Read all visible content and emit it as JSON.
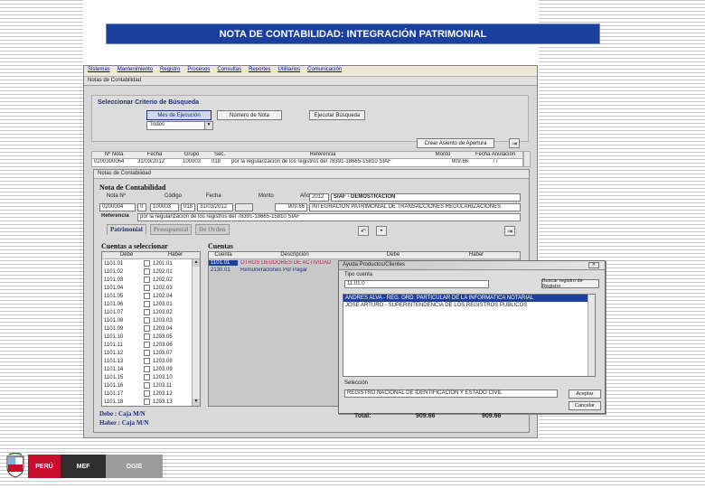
{
  "slide": {
    "title": "NOTA DE CONTABILIDAD: INTEGRACIÓN PATRIMONIAL"
  },
  "menu": [
    "Sistemas",
    "Mantenimiento",
    "Registro",
    "Procesos",
    "Consultas",
    "Reportes",
    "Utilitarios",
    "Comunicación"
  ],
  "window_title": "Notas de Contabilidad",
  "criteria": {
    "legend": "Seleccionar Criterio de Búsqueda",
    "btn_mes": "Mes de Ejecución",
    "btn_numero": "Número de Nota",
    "btn_ejecutar": "Ejecutar Búsqueda",
    "select_value": "Todos",
    "btn_crear": "Crear Asiento de Apertura"
  },
  "grid": {
    "headers": [
      "Nº Nota",
      "Fecha",
      "Grupo",
      "Sec.",
      "Referencia",
      "Monto",
      "Fecha Anulación"
    ],
    "row": [
      "0200300064",
      "31/03/2012",
      "100003",
      "018",
      "por la regularización de los registros del 78391-18665-15810 SIAF",
      "909.66",
      "/ /"
    ]
  },
  "nota": {
    "window_title": "Notas de Contabilidad",
    "heading": "Nota de Contabilidad",
    "labels": [
      "Nota Nº",
      "Código",
      "Fecha",
      "Monto",
      "Año"
    ],
    "numero": "0200004",
    "sec": "0",
    "codigo": "100003",
    "sub": "018",
    "fecha": "31/03/2012",
    "monto": "909.66",
    "anio": "2012",
    "tipo": "SIAF - DEMOSTRACION",
    "descripcion": "INTEGRACION PATRIMONIAL DE TRANSACCIONES REGULARIZACIONES",
    "referencia_label": "Referencia",
    "referencia": "por la regularización de los registros del 78391-18665-15810 SIAF"
  },
  "tabs": [
    "Patrimonial",
    "Presupuestal",
    "De Orden"
  ],
  "cuentas_sel": {
    "title": "Cuentas a seleccionar",
    "col_debe": "Debe",
    "col_haber": "Haber",
    "rows": [
      [
        "1101.01",
        "1201.01"
      ],
      [
        "1101.02",
        "1202.01"
      ],
      [
        "1101.03",
        "1202.02"
      ],
      [
        "1101.04",
        "1202.03"
      ],
      [
        "1101.05",
        "1202.04"
      ],
      [
        "1101.06",
        "1203.01"
      ],
      [
        "1101.07",
        "1203.02"
      ],
      [
        "1101.08",
        "1203.03"
      ],
      [
        "1101.09",
        "1203.04"
      ],
      [
        "1101.10",
        "1203.05"
      ],
      [
        "1101.11",
        "1203.06"
      ],
      [
        "1101.12",
        "1203.07"
      ],
      [
        "1101.13",
        "1203.08"
      ],
      [
        "1101.14",
        "1203.09"
      ],
      [
        "1101.15",
        "1203.10"
      ],
      [
        "1101.16",
        "1203.11"
      ],
      [
        "1101.17",
        "1203.12"
      ],
      [
        "1101.18",
        "1203.13"
      ]
    ]
  },
  "cuentas": {
    "title": "Cuentas",
    "headers": [
      "Cuenta",
      "Descripción",
      "Debe",
      "Haber"
    ],
    "rows": [
      {
        "cuenta": "1101.01",
        "desc": "OTROS DEUDORES DE ACTIVIDAD"
      },
      {
        "cuenta": "2130.01",
        "desc": "Remuneraciones Por Pagar"
      }
    ]
  },
  "debe_text": "Debe : Caja M/N",
  "haber_text": "Haber : Caja M/N",
  "total": {
    "label": "Total:",
    "debe": "909.66",
    "haber": "909.66"
  },
  "popup": {
    "title": "Ayuda Productos/Clientes",
    "label_search": "Tipo cuenta",
    "search_value": "11.01.0",
    "btn_buscar": "Buscar registro de Registro",
    "items": [
      "ANDRES ALVA - REG. ORD. PARTICULAR DE LA INFORMATICA NOTARIAL",
      "JOSE ARTURO - SUPERINTENDENCIA DE LOS REGISTROS PUBLICOS"
    ],
    "label_sel": "Selección",
    "sel_value": "REGISTRO NACIONAL DE IDENTIFICACION Y ESTADO CIVIL",
    "btn_aceptar": "Aceptar",
    "btn_cancelar": "Cancelar"
  },
  "footer": {
    "peru": "PERÚ",
    "mef": "MEF",
    "ogie": "OGIE"
  },
  "colors": {
    "title_bg": "#1a3f9c",
    "select_bg": "#1d3f9e",
    "peru_red": "#c8102e"
  }
}
